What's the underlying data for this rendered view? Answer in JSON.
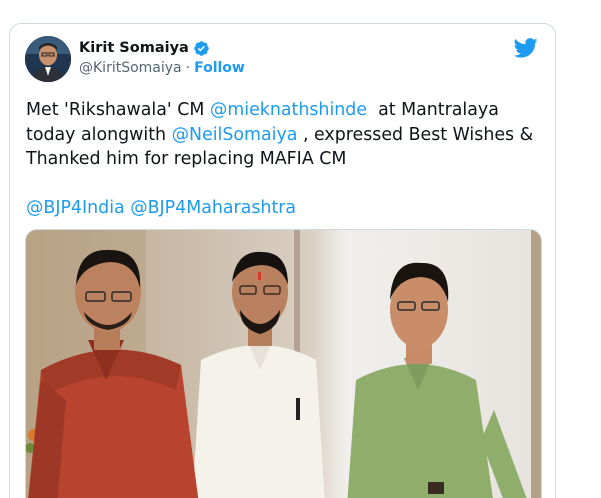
{
  "author": {
    "display_name": "Kirit Somaiya",
    "handle": "@KiritSomaiya",
    "separator": "·",
    "follow_label": "Follow"
  },
  "tweet": {
    "line1_prefix": "Met 'Rikshawala' CM ",
    "line1_mention": "@mieknathshinde",
    "line1_suffix": "  at Mantralaya",
    "line2_prefix": "today alongwith ",
    "line2_mention": "@NeilSomaiya",
    "line2_suffix": " , expressed Best Wishes &",
    "line3": "Thanked him for replacing MAFIA CM",
    "hashtag_line_mention1": "@BJP4India",
    "hashtag_line_mention2": "@BJP4Maharashtra"
  },
  "colors": {
    "accent": "#1d9bf0",
    "text": "#0f1419",
    "muted": "#536471",
    "border": "#cfd9de"
  },
  "icons": {
    "verified": "verified-badge-icon",
    "brand": "twitter-bird-icon"
  }
}
